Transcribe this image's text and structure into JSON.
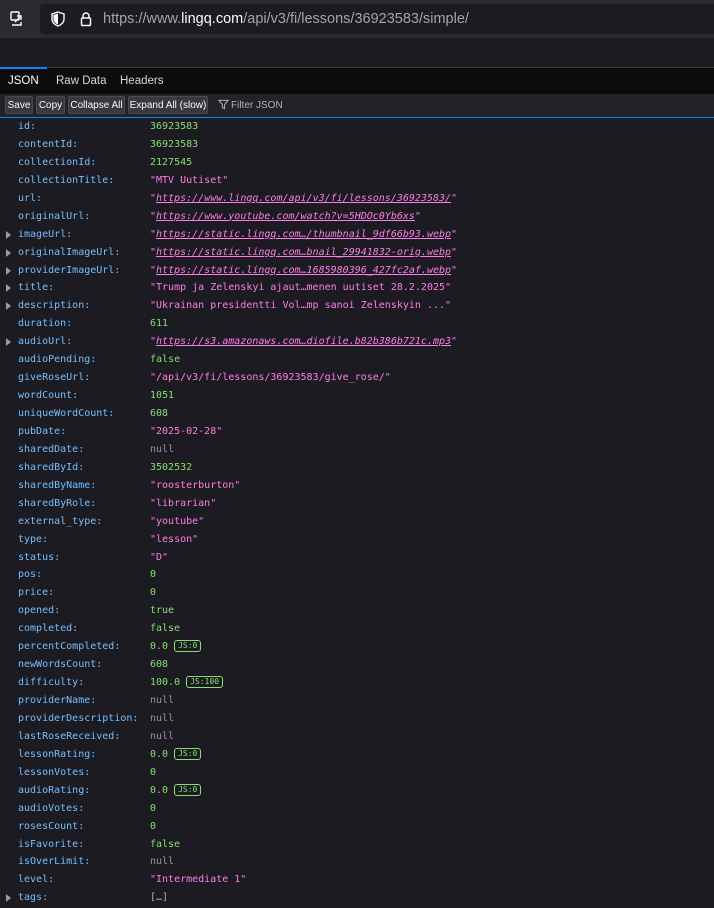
{
  "browser": {
    "url_prefix": "https://www.",
    "url_host": "lingq.com",
    "url_path": "/api/v3/fi/lessons/36923583/simple/"
  },
  "tabs": [
    {
      "label": "JSON"
    },
    {
      "label": "Raw Data"
    },
    {
      "label": "Headers"
    }
  ],
  "toolbar": {
    "save": "Save",
    "copy": "Copy",
    "collapse": "Collapse All",
    "expand": "Expand All (slow)",
    "filter_placeholder": "Filter JSON"
  },
  "colors": {
    "key": "#75bfff",
    "string": "#ff7de9",
    "number": "#86de74",
    "null": "#939395",
    "accent": "#0a84ff"
  },
  "rows": [
    {
      "key": "id:",
      "value": "36923583",
      "type": "num"
    },
    {
      "key": "contentId:",
      "value": "36923583",
      "type": "num"
    },
    {
      "key": "collectionId:",
      "value": "2127545",
      "type": "num"
    },
    {
      "key": "collectionTitle:",
      "value": "\"MTV Uutiset\"",
      "type": "str"
    },
    {
      "key": "url:",
      "value": "https://www.lingq.com/api/v3/fi/lessons/36923583/",
      "type": "url"
    },
    {
      "key": "originalUrl:",
      "value": "https://www.youtube.com/watch?v=5HDOc0Yb6xs",
      "type": "url"
    },
    {
      "key": "imageUrl:",
      "value": "https://static.lingq.com…/thumbnail_9df66b93.webp",
      "type": "url",
      "expandable": true
    },
    {
      "key": "originalImageUrl:",
      "value": "https://static.lingq.com…bnail_29941832-orig.webp",
      "type": "url",
      "expandable": true
    },
    {
      "key": "providerImageUrl:",
      "value": "https://static.lingq.com…1685980396_427fc2af.webp",
      "type": "url",
      "expandable": true
    },
    {
      "key": "title:",
      "value": "\"Trump ja Zelenskyi ajaut…menen uutiset 28.2.2025\"",
      "type": "str",
      "expandable": true
    },
    {
      "key": "description:",
      "value": "\"Ukrainan presidentti Vol…mp sanoi Zelenskyin ...\"",
      "type": "str",
      "expandable": true
    },
    {
      "key": "duration:",
      "value": "611",
      "type": "num"
    },
    {
      "key": "audioUrl:",
      "value": "https://s3.amazonaws.com…diofile.b82b386b721c.mp3",
      "type": "url",
      "expandable": true
    },
    {
      "key": "audioPending:",
      "value": "false",
      "type": "num"
    },
    {
      "key": "giveRoseUrl:",
      "value": "\"/api/v3/fi/lessons/36923583/give_rose/\"",
      "type": "str"
    },
    {
      "key": "wordCount:",
      "value": "1051",
      "type": "num"
    },
    {
      "key": "uniqueWordCount:",
      "value": "608",
      "type": "num"
    },
    {
      "key": "pubDate:",
      "value": "\"2025-02-28\"",
      "type": "str"
    },
    {
      "key": "sharedDate:",
      "value": "null",
      "type": "null"
    },
    {
      "key": "sharedById:",
      "value": "3502532",
      "type": "num"
    },
    {
      "key": "sharedByName:",
      "value": "\"roosterburton\"",
      "type": "str"
    },
    {
      "key": "sharedByRole:",
      "value": "\"librarian\"",
      "type": "str"
    },
    {
      "key": "external_type:",
      "value": "\"youtube\"",
      "type": "str"
    },
    {
      "key": "type:",
      "value": "\"lesson\"",
      "type": "str"
    },
    {
      "key": "status:",
      "value": "\"D\"",
      "type": "str"
    },
    {
      "key": "pos:",
      "value": "0",
      "type": "num"
    },
    {
      "key": "price:",
      "value": "0",
      "type": "num"
    },
    {
      "key": "opened:",
      "value": "true",
      "type": "num"
    },
    {
      "key": "completed:",
      "value": "false",
      "type": "num"
    },
    {
      "key": "percentCompleted:",
      "value": "0.0",
      "type": "num",
      "badge": "JS:0"
    },
    {
      "key": "newWordsCount:",
      "value": "608",
      "type": "num"
    },
    {
      "key": "difficulty:",
      "value": "100.0",
      "type": "num",
      "badge": "JS:100"
    },
    {
      "key": "providerName:",
      "value": "null",
      "type": "null"
    },
    {
      "key": "providerDescription:",
      "value": "null",
      "type": "null"
    },
    {
      "key": "lastRoseReceived:",
      "value": "null",
      "type": "null"
    },
    {
      "key": "lessonRating:",
      "value": "0.0",
      "type": "num",
      "badge": "JS:0"
    },
    {
      "key": "lessonVotes:",
      "value": "0",
      "type": "num"
    },
    {
      "key": "audioRating:",
      "value": "0.0",
      "type": "num",
      "badge": "JS:0"
    },
    {
      "key": "audioVotes:",
      "value": "0",
      "type": "num"
    },
    {
      "key": "rosesCount:",
      "value": "0",
      "type": "num"
    },
    {
      "key": "isFavorite:",
      "value": "false",
      "type": "num"
    },
    {
      "key": "isOverLimit:",
      "value": "null",
      "type": "null"
    },
    {
      "key": "level:",
      "value": "\"Intermediate 1\"",
      "type": "str"
    },
    {
      "key": "tags:",
      "value": "[…]",
      "type": "arr",
      "expandable": true
    }
  ]
}
